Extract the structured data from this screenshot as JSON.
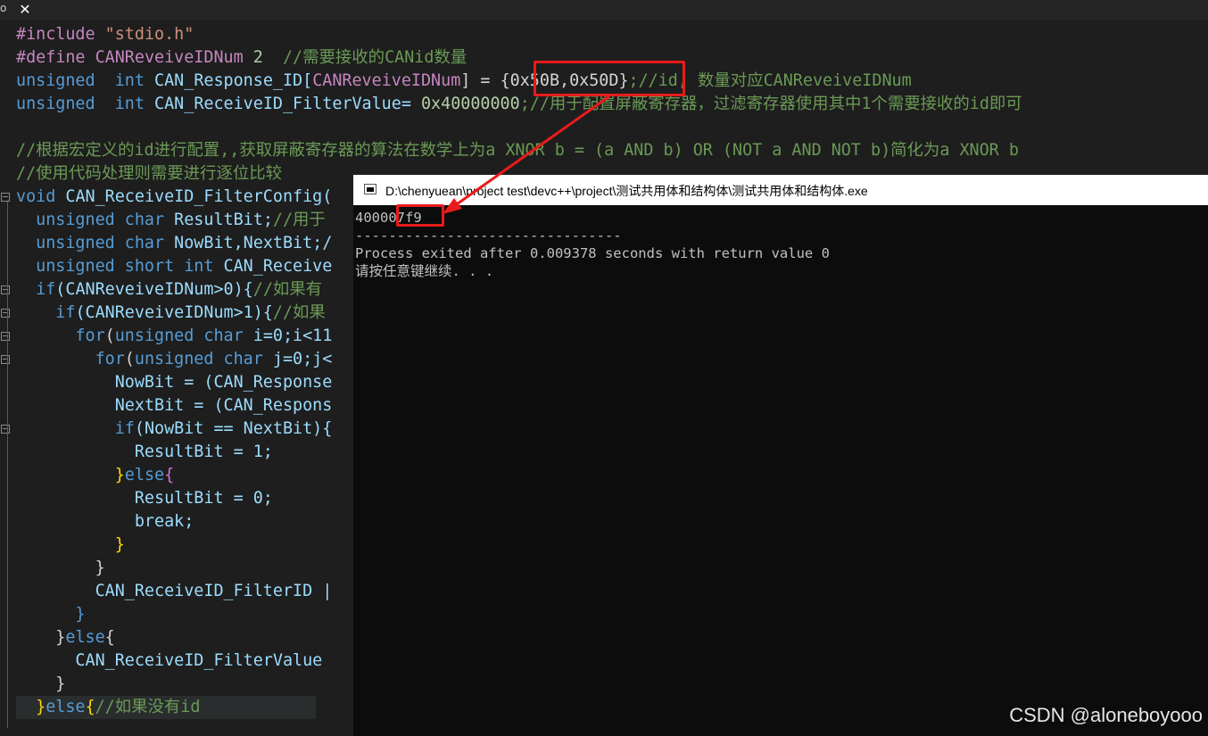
{
  "tab": {
    "prefix": "o",
    "close_glyph": "✕"
  },
  "code": {
    "l1": {
      "pp": "#include",
      "str": " \"stdio.h\""
    },
    "l2": {
      "pp": "#define",
      "mac": " CANReveiveIDNum",
      "num": " 2",
      "cm": "  //需要接收的CANid数量"
    },
    "l3": {
      "kw1": "unsigned",
      "kw2": "  int",
      "id": " CAN_Response_ID[",
      "mac": "CANReveiveIDNum",
      "rest": "] = ",
      "arr": "{0x50B,0x50D}",
      "cm": ";//id, 数量对应CANReveiveIDNum"
    },
    "l4": {
      "kw1": "unsigned",
      "kw2": "  int",
      "id": " CAN_ReceiveID_FilterValue= ",
      "num": "0x40000000",
      "cm": ";//用于配置屏蔽寄存器，过滤寄存器使用其中1个需要接收的id即可"
    },
    "l6": {
      "cm": "//根据宏定义的id进行配置,,获取屏蔽寄存器的算法在数学上为a XNOR b = (a AND b) OR (NOT a AND NOT b)简化为a XNOR b"
    },
    "l7": {
      "cm": "//使用代码处理则需要进行逐位比较"
    },
    "l8": {
      "kw": "void",
      "id": " CAN_ReceiveID_FilterConfig("
    },
    "l9": {
      "kw": "  unsigned char",
      "id": " ResultBit;",
      "cm": "//用于"
    },
    "l10": {
      "kw": "  unsigned char",
      "id": " NowBit,NextBit;/"
    },
    "l11": {
      "kw": "  unsigned short int",
      "id": " CAN_Receive"
    },
    "l12": {
      "kw": "  if",
      "id": "(CANReveiveIDNum>0){",
      "cm": "//如果有"
    },
    "l13": {
      "kw": "    if",
      "id": "(CANReveiveIDNum>1){",
      "cm": "//如果"
    },
    "l14": {
      "kw": "      for",
      "id": "(",
      "kw2": "unsigned char",
      "id2": " i=0;i<11"
    },
    "l15": {
      "kw": "        for",
      "id": "(",
      "kw2": "unsigned char",
      "id2": " j=0;j<"
    },
    "l16": {
      "id": "          NowBit = (CAN_Response"
    },
    "l17": {
      "id": "          NextBit = (CAN_Respons"
    },
    "l18": {
      "kw": "          if",
      "id": "(NowBit == NextBit){"
    },
    "l19": {
      "id": "            ResultBit = 1;"
    },
    "l20": {
      "br": "          }",
      "kw": "else",
      "br2": "{"
    },
    "l21": {
      "id": "            ResultBit = 0;"
    },
    "l22": {
      "id": "            break;"
    },
    "l23": {
      "br": "          }"
    },
    "l24": {
      "id": "        }"
    },
    "l25": {
      "id": "        CAN_ReceiveID_FilterID |"
    },
    "l26": {
      "id": "      }"
    },
    "l27": {
      "br": "    }",
      "kw": "else",
      "br2": "{"
    },
    "l28": {
      "id": "      CAN_ReceiveID_FilterValue"
    },
    "l29": {
      "id": "    }"
    },
    "l30": {
      "br": "  }",
      "kw": "else",
      "br2": "{",
      "cm": "//如果没有id"
    }
  },
  "console": {
    "title": "D:\\chenyuean\\project test\\devc++\\project\\测试共用体和结构体\\测试共用体和结构体.exe",
    "output": "400007f9",
    "separator": "--------------------------------",
    "exit_line": "Process exited after 0.009378 seconds with return value 0",
    "prompt": "请按任意键继续. . ."
  },
  "watermark": "CSDN @aloneboyooo",
  "colors": {
    "annotation": "#e81b1b",
    "keyword": "#569cd6",
    "comment": "#6a9955",
    "identifier": "#9cdcfe"
  }
}
